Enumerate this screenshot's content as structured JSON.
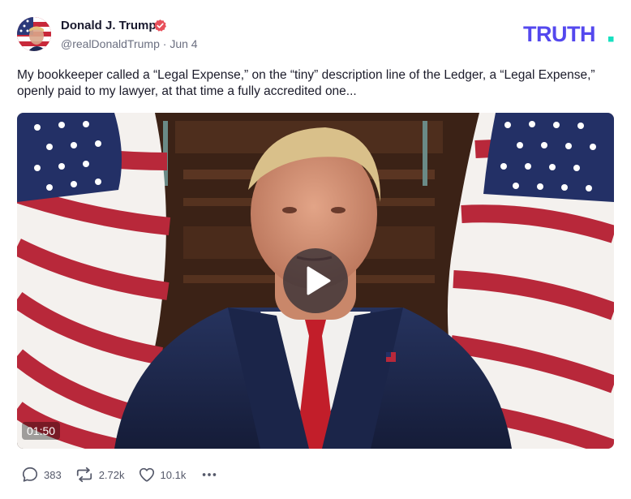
{
  "author": {
    "display_name": "Donald J. Trump",
    "handle": "@realDonaldTrump",
    "separator": "·",
    "date": "Jun 4",
    "verified_icon": "verified-badge-icon",
    "verified_color": "#e8505b"
  },
  "brand": {
    "logo_text": "TRUTH",
    "logo_color": "#5448ee",
    "logo_dot_color": "#17e0c0"
  },
  "post": {
    "text": "My bookkeeper called a “Legal Expense,” on the “tiny” description line of the Ledger, a “Legal Expense,” openly paid to my lawyer, at that time a fully accredited one..."
  },
  "video": {
    "duration": "01:50",
    "play_icon": "play-icon"
  },
  "actions": {
    "replies": "383",
    "retruths": "2.72k",
    "likes": "10.1k",
    "reply_icon": "reply-bubble-icon",
    "retruth_icon": "retruth-icon",
    "like_icon": "heart-icon",
    "more_icon": "more-dots-icon"
  }
}
